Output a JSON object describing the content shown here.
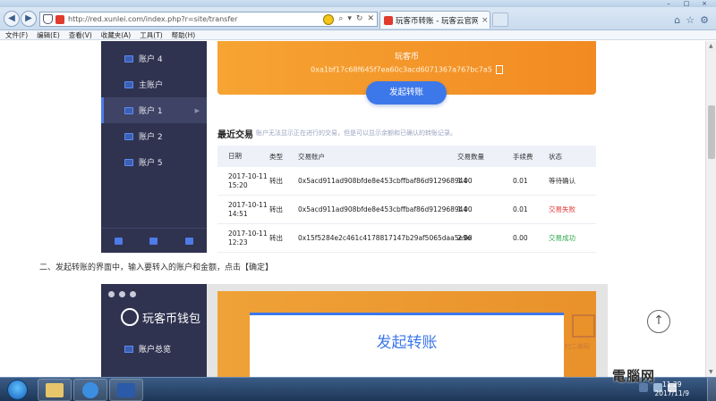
{
  "browser": {
    "url": "http://red.xunlei.com/index.php?r=site/transfer",
    "tab_title": "玩客币转账 - 玩客云官网...",
    "tab_close": "×",
    "back": "◀",
    "forward": "▶",
    "window_controls": [
      "–",
      "□",
      "×"
    ],
    "menu": [
      "文件(F)",
      "编辑(E)",
      "查看(V)",
      "收藏夹(A)",
      "工具(T)",
      "帮助(H)"
    ]
  },
  "sidebar": {
    "items": [
      {
        "label": "账户 4"
      },
      {
        "label": "主账户"
      },
      {
        "label": "账户 1",
        "active": true
      },
      {
        "label": "账户 2"
      },
      {
        "label": "账户 5"
      }
    ]
  },
  "wallet": {
    "coin_name": "玩客币",
    "address": "0xa1bf17c68f645f7ea60c3acd6071367a767bc7a5",
    "send_button": "发起转账"
  },
  "transactions": {
    "title": "最近交易",
    "note": "账户无法显示正在进行的交易，但是可以显示余额和已确认的转账记录。",
    "headers": [
      "日期",
      "类型",
      "交易账户",
      "交易数量",
      "手续费",
      "状态"
    ],
    "rows": [
      {
        "date": "2017-10-11",
        "time": "15:20",
        "type": "转出",
        "account": "0x5acd911ad908bfde8e453cbffbaf86d912968944",
        "amount": "1.00",
        "fee": "0.01",
        "status": "等待确认",
        "status_color": "#333333"
      },
      {
        "date": "2017-10-11",
        "time": "14:51",
        "type": "转出",
        "account": "0x5acd911ad908bfde8e453cbffbaf86d912968944",
        "amount": "1.00",
        "fee": "0.01",
        "status": "交易失败",
        "status_color": "#e53935"
      },
      {
        "date": "2017-10-11",
        "time": "12:23",
        "type": "转出",
        "account": "0x15f5284e2c461c4178817147b29af5065daa5e9e",
        "amount": "2.00",
        "fee": "0.00",
        "status": "交易成功",
        "status_color": "#2fa84f"
      }
    ]
  },
  "article": {
    "step_text": "二、发起转账的界面中，输入要转入的账户和金额，点击【确定】"
  },
  "screenshot2": {
    "logo": "玩客币钱包",
    "sidebar_item": "账户总览",
    "dialog_title": "发起转账",
    "qr_label": "扫二维码"
  },
  "taskbar": {
    "time": "11:29",
    "date": "2017/11/9"
  },
  "watermark": "電腦网",
  "colors": {
    "accent": "#3d78ea",
    "sidebar": "#2f3350",
    "orange": "#f6a433"
  }
}
